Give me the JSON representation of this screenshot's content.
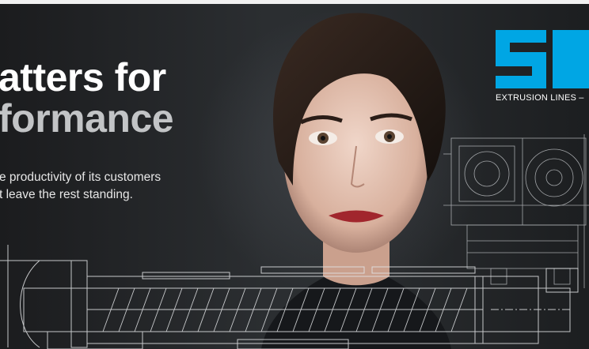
{
  "headline": {
    "line1": "atters for",
    "line2": "formance"
  },
  "subtext": {
    "line1": "e productivity of its customers",
    "line2": "t leave the rest standing."
  },
  "logo": {
    "mark": "SI",
    "tagline": "EXTRUSION LINES –",
    "color": "#00a6e4"
  },
  "colors": {
    "background": "#1e2022",
    "headline_primary": "#ffffff",
    "headline_secondary": "#c2c4c6",
    "line_art": "#d9dbdd"
  }
}
